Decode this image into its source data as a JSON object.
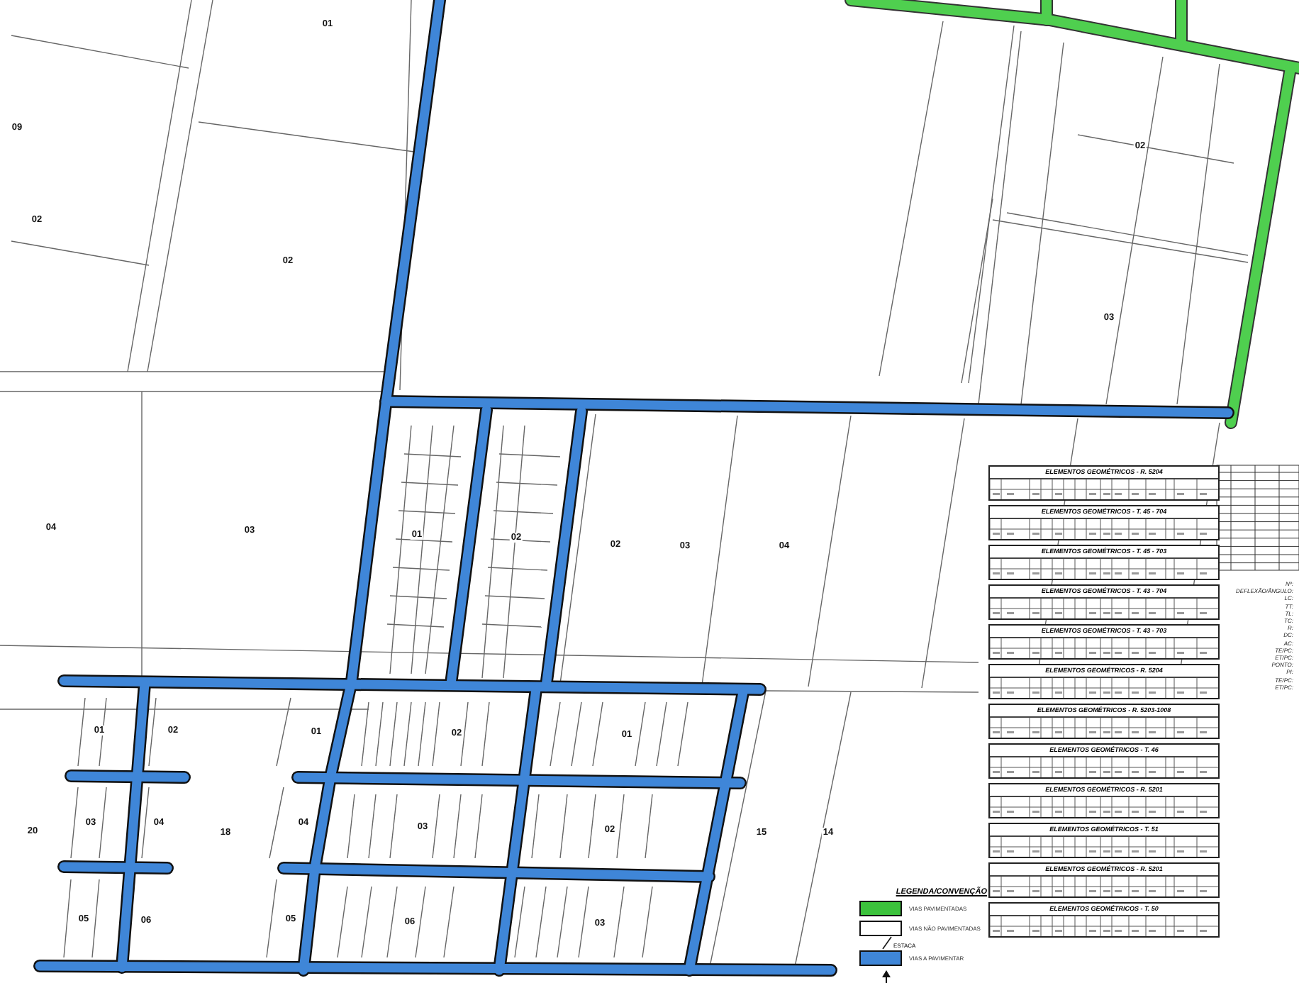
{
  "plan": {
    "lot_labels": [
      "01",
      "09",
      "02",
      "02",
      "02",
      "03",
      "04",
      "03",
      "01",
      "02",
      "02",
      "03",
      "04",
      "01",
      "02",
      "01",
      "02",
      "01",
      "20",
      "03",
      "04",
      "18",
      "04",
      "03",
      "02",
      "15",
      "14",
      "05",
      "06",
      "05",
      "06",
      "03"
    ]
  },
  "geometry_tables": [
    {
      "title": "ELEMENTOS GEOMÉTRICOS - R. 5204"
    },
    {
      "title": "ELEMENTOS GEOMÉTRICOS - T. 45 - 704"
    },
    {
      "title": "ELEMENTOS GEOMÉTRICOS - T. 45 - 703"
    },
    {
      "title": "ELEMENTOS GEOMÉTRICOS - T. 43 - 704"
    },
    {
      "title": "ELEMENTOS GEOMÉTRICOS - T. 43 - 703"
    },
    {
      "title": "ELEMENTOS GEOMÉTRICOS - R. 5204"
    },
    {
      "title": "ELEMENTOS GEOMÉTRICOS - R. 5203-1008"
    },
    {
      "title": "ELEMENTOS GEOMÉTRICOS - T. 46"
    },
    {
      "title": "ELEMENTOS GEOMÉTRICOS - R. 5201"
    },
    {
      "title": "ELEMENTOS GEOMÉTRICOS - T. 51"
    },
    {
      "title": "ELEMENTOS GEOMÉTRICOS - R. 5201"
    },
    {
      "title": "ELEMENTOS GEOMÉTRICOS - T. 50"
    }
  ],
  "notation": [
    "Nº:",
    "DEFLEXÃO/ÂNGULO:",
    "LC:",
    "TT:",
    "TL:",
    "TC:",
    "R:",
    "DC:",
    "AC:",
    "TE/PC:",
    "ET/PC:",
    "PONTO:",
    "PI:",
    "TE/PC:",
    "ET/PC:"
  ],
  "legend": {
    "title": "LEGENDA/CONVENÇÃO",
    "items": [
      {
        "kind": "paved",
        "label": "VIAS PAVIMENTADAS"
      },
      {
        "kind": "unpaved",
        "label": "VIAS NÃO PAVIMENTADAS"
      },
      {
        "kind": "to_pave",
        "label": "VIAS A PAVIMENTAR"
      }
    ],
    "stake_label": "ESTACA"
  }
}
